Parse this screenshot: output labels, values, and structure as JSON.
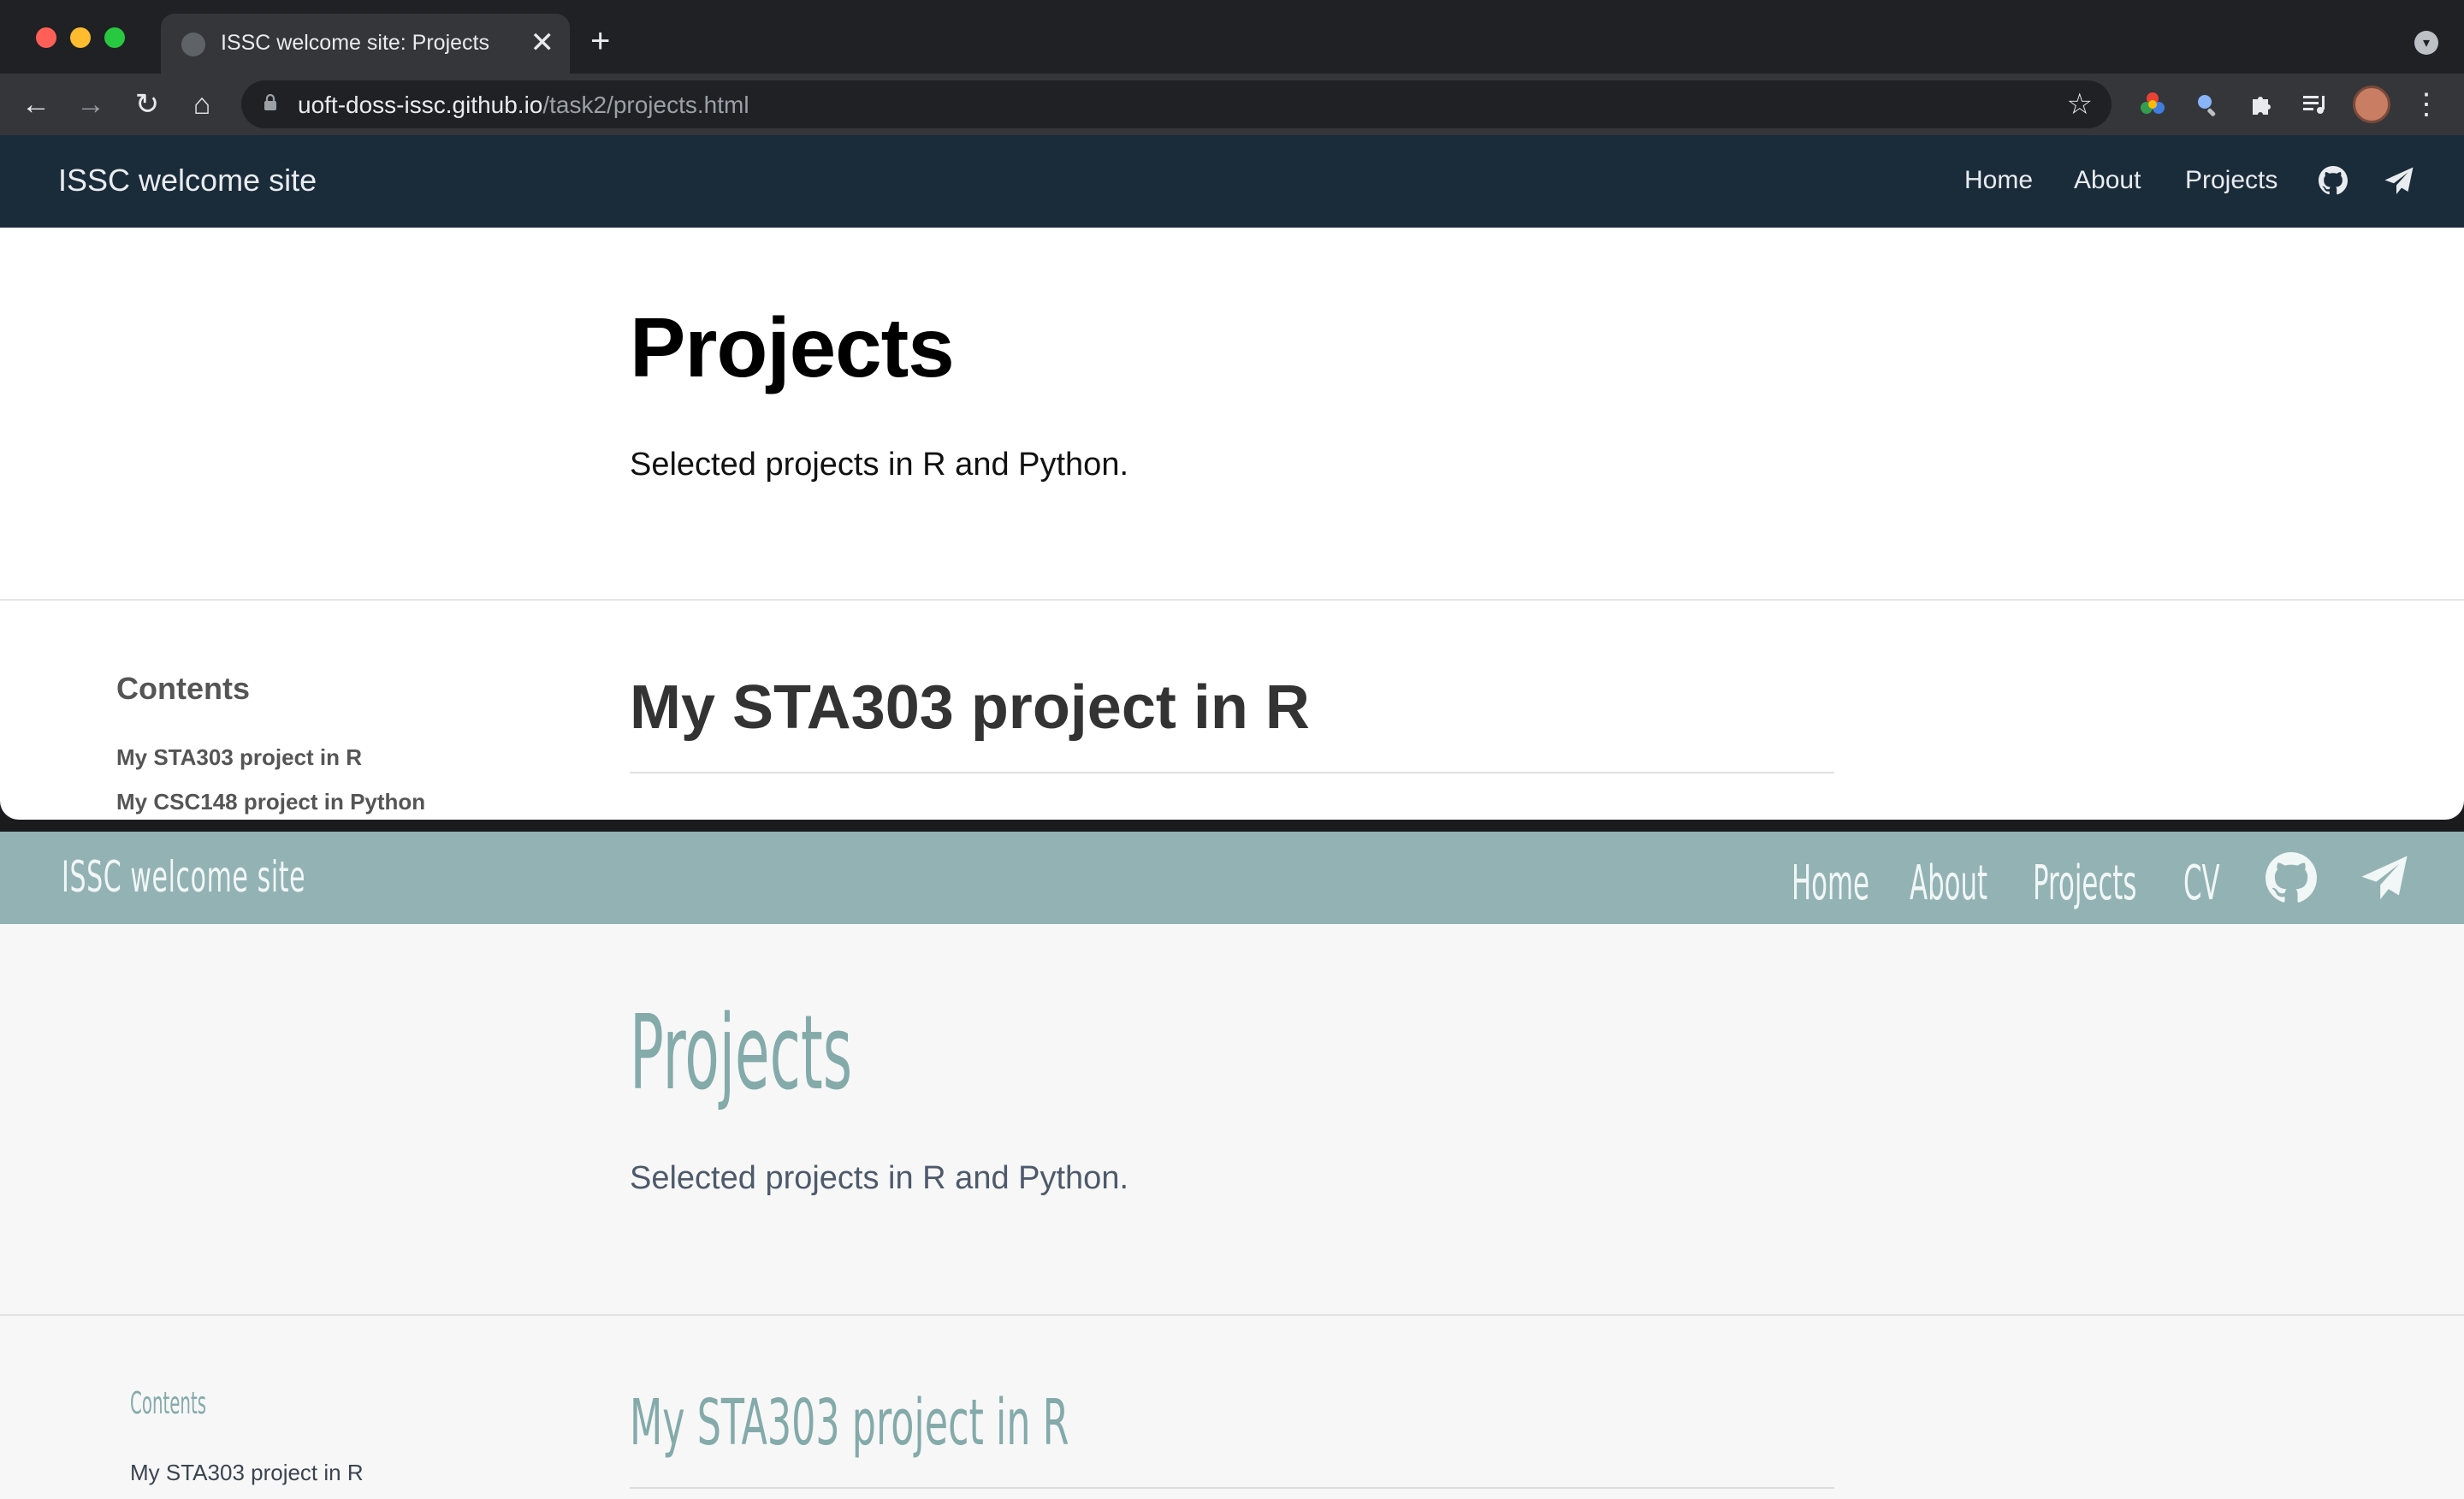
{
  "browser": {
    "tab_title": "ISSC welcome site: Projects",
    "new_tab": "+",
    "close_tab": "✕",
    "url_host": "uoft-doss-issc.github.io",
    "url_path": "/task2/projects.html"
  },
  "site1": {
    "brand": "ISSC welcome site",
    "nav": [
      "Home",
      "About",
      "Projects"
    ],
    "hero_title": "Projects",
    "hero_subtitle": "Selected projects in R and Python.",
    "toc_heading": "Contents",
    "toc_items": [
      "My STA303 project in R",
      "My CSC148 project in Python"
    ],
    "section_title": "My STA303 project in R"
  },
  "site2": {
    "brand": "ISSC welcome site",
    "nav": [
      "Home",
      "About",
      "Projects",
      "CV"
    ],
    "hero_title": "Projects",
    "hero_subtitle": "Selected projects in R and Python.",
    "toc_heading": "Contents",
    "toc_items": [
      "My STA303 project in R"
    ],
    "section_title": "My STA303 project in R"
  },
  "colors": {
    "site1_navbar": "#1a2b3a",
    "site2_navbar": "#93b2b3",
    "site2_accent": "#84aaaa"
  }
}
